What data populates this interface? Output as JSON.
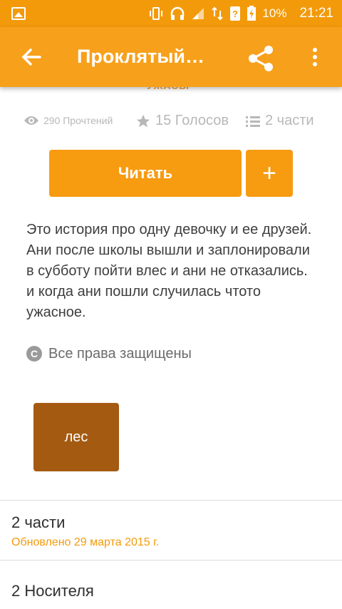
{
  "status_bar": {
    "battery": "10%",
    "time": "21:21"
  },
  "app_bar": {
    "title": "Проклятый…"
  },
  "story": {
    "category": "УЖАСЫ",
    "reads": "290 Прочтений",
    "votes": "15 Голосов",
    "parts": "2 части",
    "read_button": "Читать",
    "add_button": "+",
    "description": "Это история про одну девочку и ее друзей. Ани после школы вышли и заплонировали в субботу пойти влес и ани не отказались. и когда ани пошли случилась чтото ужасное.",
    "rights": "Все права защищены",
    "tag": "лес"
  },
  "parts_section": {
    "title": "2 части",
    "updated": "Обновлено 29 марта 2015 г."
  },
  "carriers_section": {
    "title": "2 Носителя"
  },
  "colors": {
    "accent": "#f7a01b",
    "tag": "#a55a12",
    "updated": "#f39a0b"
  }
}
